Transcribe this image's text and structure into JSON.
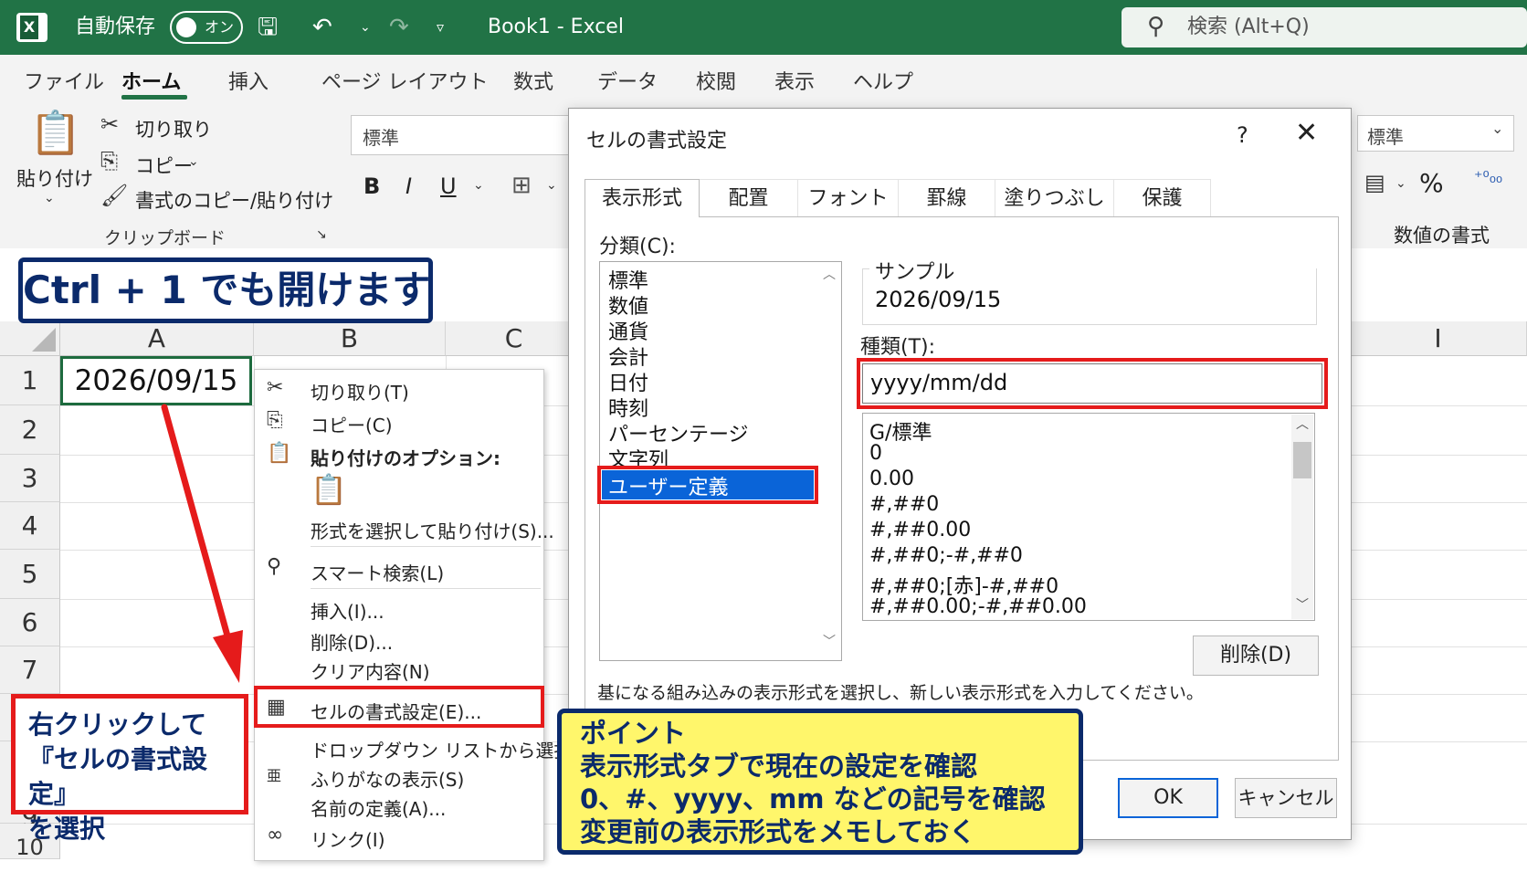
{
  "titlebar": {
    "autosave_label": "自動保存",
    "autosave_state": "オン",
    "doc_title": "Book1  -  Excel",
    "search_placeholder": "検索 (Alt+Q)",
    "color": "#217346"
  },
  "menu": {
    "tabs": [
      "ファイル",
      "ホーム",
      "挿入",
      "ページ レイアウト",
      "数式",
      "データ",
      "校閲",
      "表示",
      "ヘルプ"
    ],
    "active": "ホーム"
  },
  "ribbon": {
    "paste_label": "貼り付け",
    "cut_label": "切り取り",
    "copy_label": "コピー",
    "format_painter_label": "書式のコピー/貼り付け",
    "clipboard_group": "クリップボード",
    "font_name": "標準",
    "number_format": "標準",
    "number_group": "数値の書式",
    "bold": "B",
    "italic": "I",
    "underline": "U",
    "percent": "%"
  },
  "sheet": {
    "columns": [
      "A",
      "B",
      "C",
      "I"
    ],
    "rows": [
      "1",
      "2",
      "3",
      "4",
      "5",
      "6",
      "7",
      "8",
      "9",
      "10"
    ],
    "cell_a1": "2026/09/15"
  },
  "callouts": {
    "ctrl_shortcut": "Ctrl + 1 でも開けます",
    "right_click": [
      "右クリックして",
      "『セルの書式設定』",
      "を選択"
    ],
    "point": [
      "ポイント",
      "表示形式タブで現在の設定を確認",
      "0、#、yyyy、mm などの記号を確認",
      "変更前の表示形式をメモしておく"
    ]
  },
  "context_menu": {
    "cut": "切り取り(T)",
    "copy": "コピー(C)",
    "paste_options": "貼り付けのオプション:",
    "paste_special": "形式を選択して貼り付け(S)...",
    "smart_lookup": "スマート検索(L)",
    "insert": "挿入(I)...",
    "delete": "削除(D)...",
    "clear": "クリア内容(N)",
    "format_cells": "セルの書式設定(E)...",
    "dropdown": "ドロップダウン リストから選択(K)...",
    "phonetic": "ふりがなの表示(S)",
    "define_name": "名前の定義(A)...",
    "link": "リンク(I)"
  },
  "dialog": {
    "title": "セルの書式設定",
    "help": "?",
    "tabs": [
      "表示形式",
      "配置",
      "フォント",
      "罫線",
      "塗りつぶし",
      "保護"
    ],
    "category_label": "分類(C):",
    "categories": [
      "標準",
      "数値",
      "通貨",
      "会計",
      "日付",
      "時刻",
      "パーセンテージ",
      "文字列"
    ],
    "selected_category": "ユーザー定義",
    "sample_label": "サンプル",
    "sample_value": "2026/09/15",
    "type_label": "種類(T):",
    "type_value": "yyyy/mm/dd",
    "formats": [
      "G/標準",
      "0",
      "0.00",
      "#,##0",
      "#,##0.00",
      "#,##0;-#,##0",
      "#,##0;[赤]-#,##0",
      "#,##0.00;-#,##0.00"
    ],
    "delete_button": "削除(D)",
    "description": "基になる組み込みの表示形式を選択し、新しい表示形式を入力してください。",
    "ok": "OK",
    "cancel": "キャンセル"
  },
  "colors": {
    "highlight_red": "#e51b1b",
    "navy": "#0b2a6b",
    "callout_yellow": "#fff66b",
    "selection_blue": "#0a64d8"
  }
}
